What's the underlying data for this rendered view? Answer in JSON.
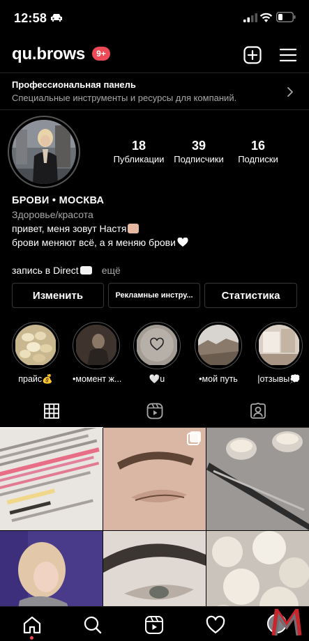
{
  "status_bar": {
    "time": "12:58"
  },
  "header": {
    "username": "qu.brows",
    "notifications_badge": "9+"
  },
  "pro_panel": {
    "title": "Профессиональная панель",
    "subtitle": "Специальные инструменты и ресурсы для компаний."
  },
  "stats": [
    {
      "value": "18",
      "label": "Публикации"
    },
    {
      "value": "39",
      "label": "Подписчики"
    },
    {
      "value": "16",
      "label": "Подписки"
    }
  ],
  "bio": {
    "name": "БРОВИ • МОСКВА",
    "category": "Здоровье/красота",
    "line1": "привет, меня зовут Настя",
    "line2": "брови меняют всё, а я меняю брови",
    "line3": "запись в Direct",
    "more": "ещё"
  },
  "buttons": {
    "edit": "Изменить",
    "ad_tools": "Рекламные инстру...",
    "stats": "Статистика"
  },
  "highlights": [
    {
      "label": "прайс💰"
    },
    {
      "label": "•момент ж..."
    },
    {
      "label": "🤍u"
    },
    {
      "label": "•мой путь"
    },
    {
      "label": "|отзывы💭"
    }
  ],
  "tabs": [
    "grid-icon",
    "reels-icon",
    "tagged-icon"
  ],
  "bottom_nav": [
    "home-icon",
    "search-icon",
    "reels-icon",
    "heart-icon",
    "profile-avatar"
  ],
  "colors": {
    "badge": "#ed4956",
    "background": "#000000",
    "secondary_text": "#a8a8a8",
    "border": "#363636"
  }
}
